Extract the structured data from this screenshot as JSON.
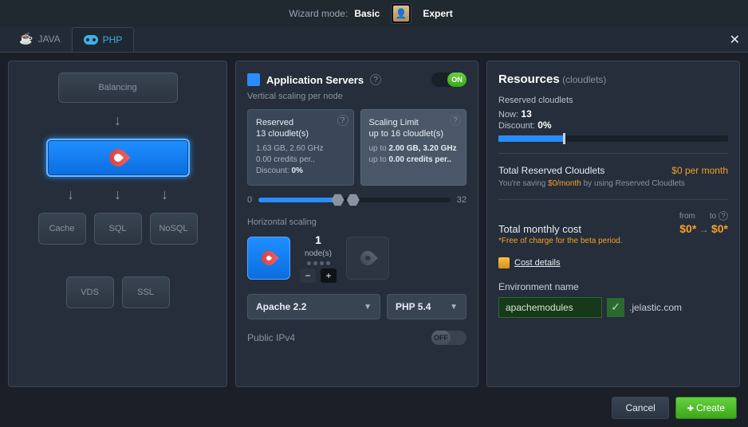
{
  "header": {
    "mode_label": "Wizard mode:",
    "basic": "Basic",
    "expert": "Expert"
  },
  "tabs": {
    "java": "JAVA",
    "php": "PHP"
  },
  "topology": {
    "balancing": "Balancing",
    "cache": "Cache",
    "sql": "SQL",
    "nosql": "NoSQL",
    "vds": "VDS",
    "ssl": "SSL"
  },
  "app": {
    "title": "Application Servers",
    "vscale_label": "Vertical scaling per node",
    "reserved": {
      "title": "Reserved",
      "sub": "13 cloudlet(s)",
      "l1": "1.63 GB, 2.60 GHz",
      "l2": "0.00 credits per..",
      "disc_label": "Discount:",
      "disc": "0%"
    },
    "limit": {
      "title": "Scaling Limit",
      "sub": "up to 16 cloudlet(s)",
      "l1_pre": "up to ",
      "l1": "2.00 GB, 3.20 GHz",
      "l2_pre": "up to ",
      "l2": "0.00 credits per.."
    },
    "slider_min": "0",
    "slider_max": "32",
    "hscale_label": "Horizontal scaling",
    "node_count": "1",
    "node_unit": "node(s)",
    "server": "Apache 2.2",
    "runtime": "PHP 5.4",
    "ipv4": "Public IPv4",
    "off": "OFF",
    "on": "ON"
  },
  "res": {
    "title": "Resources",
    "unit": "(cloudlets)",
    "reserved_label": "Reserved cloudlets",
    "now_label": "Now:",
    "now": "13",
    "disc_label": "Discount:",
    "disc": "0%",
    "trc": "Total Reserved Cloudlets",
    "trc_val": "$0 per month",
    "saving_1": "You're saving ",
    "saving_amt": "$0/month",
    "saving_2": " by using Reserved Cloudlets",
    "from": "from",
    "to": "to",
    "tmc": "Total monthly cost",
    "tmc_from": "$0*",
    "tmc_to": "$0*",
    "note": "*Free of charge for the beta period.",
    "cost_link": "Cost details",
    "env_label": "Environment name",
    "env_value": "apachemodules",
    "domain": ".jelastic.com"
  },
  "footer": {
    "cancel": "Cancel",
    "create": "Create"
  }
}
